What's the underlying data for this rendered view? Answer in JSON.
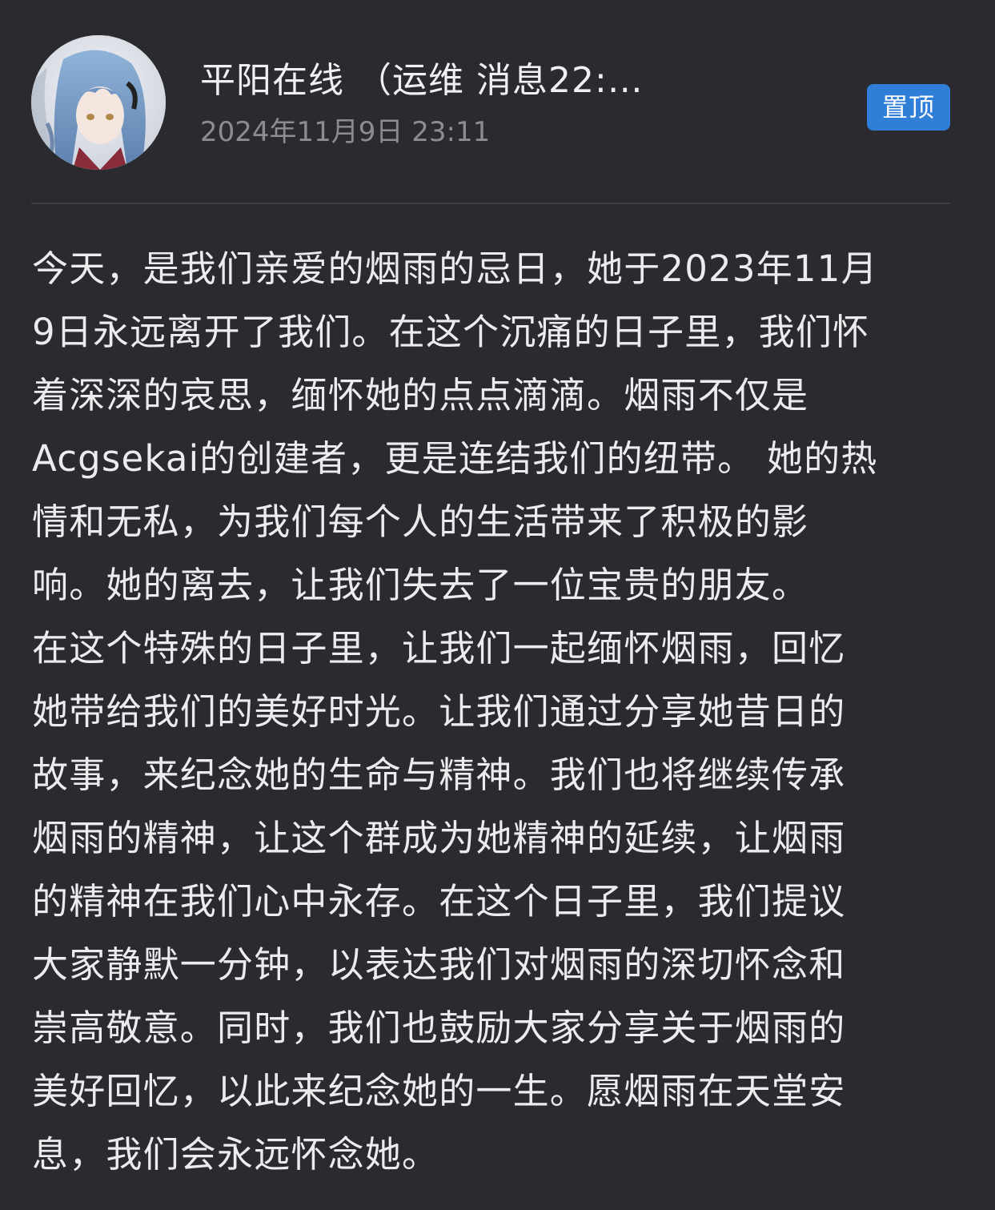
{
  "post": {
    "author_name": "平阳在线 （运维 消息22:…",
    "timestamp": "2024年11月9日 23:11",
    "pin_label": "置顶",
    "lines": [
      "今天，是我们亲爱的烟雨的忌日，她于2023年11月",
      "9日永远离开了我们。在这个沉痛的日子里，我们怀",
      "着深深的哀思，缅怀她的点点滴滴。烟雨不仅是",
      "Acgsekai的创建者，更是连结我们的纽带。 她的热",
      "情和无私，为我们每个人的生活带来了积极的影",
      "响。她的离去，让我们失去了一位宝贵的朋友。",
      "在这个特殊的日子里，让我们一起缅怀烟雨，回忆",
      "她带给我们的美好时光。让我们通过分享她昔日的",
      "故事，来纪念她的生命与精神。我们也将继续传承",
      "烟雨的精神，让这个群成为她精神的延续，让烟雨",
      "的精神在我们心中永存。在这个日子里，我们提议",
      "大家静默一分钟，以表达我们对烟雨的深切怀念和",
      "崇高敬意。同时，我们也鼓励大家分享关于烟雨的",
      "美好回忆，以此来纪念她的一生。愿烟雨在天堂安",
      "息，我们会永远怀念她。"
    ]
  },
  "colors": {
    "background": "#2b2b2f",
    "pin_badge": "#2f7ed8",
    "text": "#ececee",
    "muted": "#8c8c93"
  },
  "icons": {
    "avatar": "anime-character-avatar"
  }
}
